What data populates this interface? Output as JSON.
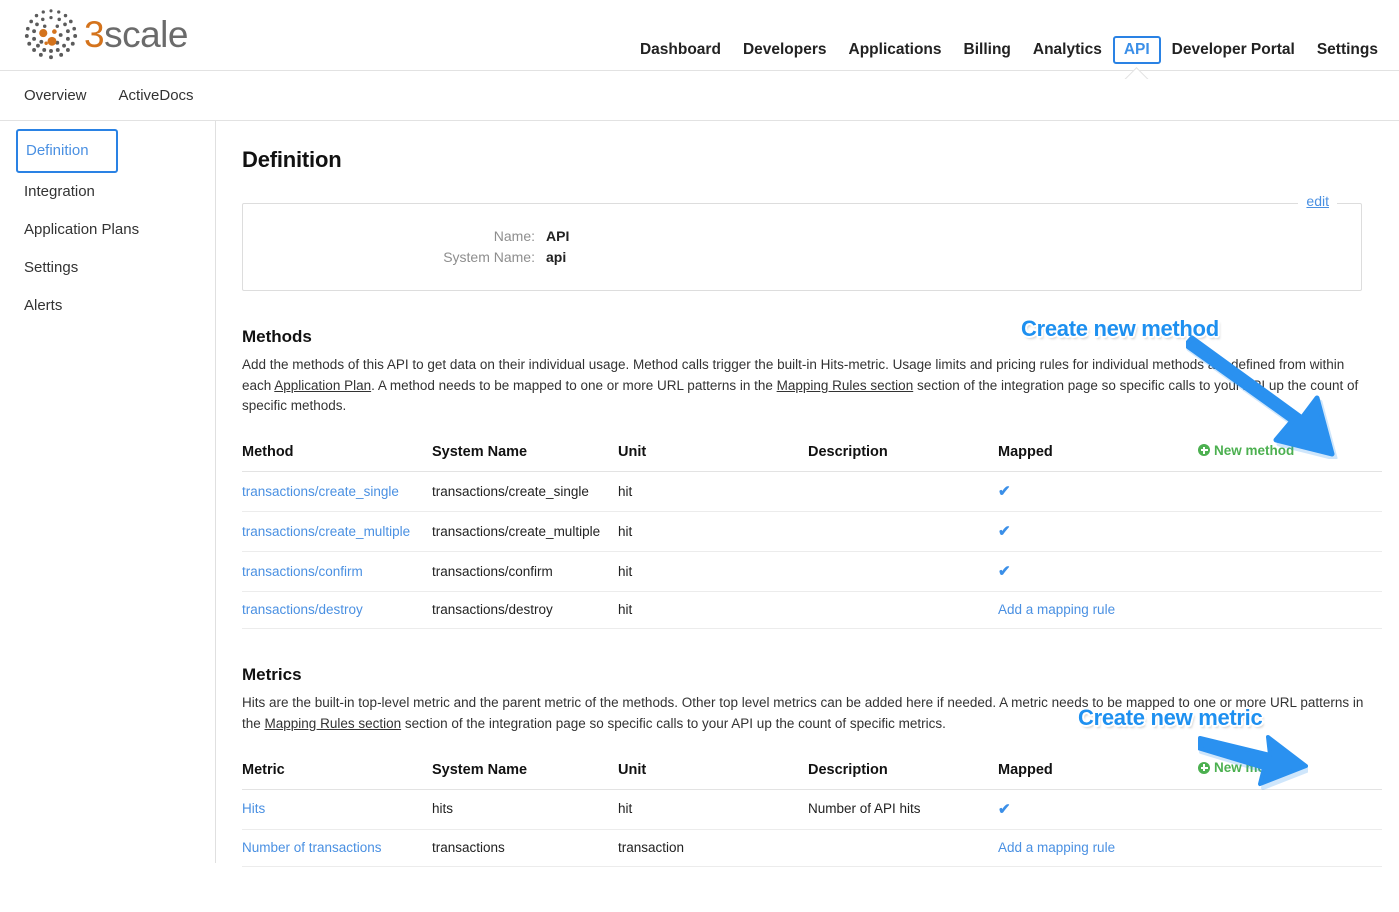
{
  "brand": {
    "logo_text_primary": "3",
    "logo_text_secondary": "scale",
    "logo_icon": "dot-cluster-logo",
    "orange": "#d4731c",
    "gray": "#6b6b6b"
  },
  "header": {
    "nav": [
      {
        "label": "Dashboard",
        "active": false
      },
      {
        "label": "Developers",
        "active": false
      },
      {
        "label": "Applications",
        "active": false
      },
      {
        "label": "Billing",
        "active": false
      },
      {
        "label": "Analytics",
        "active": false
      },
      {
        "label": "API",
        "active": true
      },
      {
        "label": "Developer Portal",
        "active": false
      },
      {
        "label": "Settings",
        "active": false
      }
    ]
  },
  "sub_tabs": [
    {
      "label": "Overview"
    },
    {
      "label": "ActiveDocs"
    }
  ],
  "sidebar": {
    "items": [
      {
        "label": "Definition",
        "active": true
      },
      {
        "label": "Integration",
        "active": false
      },
      {
        "label": "Application Plans",
        "active": false
      },
      {
        "label": "Settings",
        "active": false
      },
      {
        "label": "Alerts",
        "active": false
      }
    ]
  },
  "main": {
    "page_title": "Definition",
    "definition_panel": {
      "edit_label": "edit",
      "rows": [
        {
          "label": "Name:",
          "value": "API"
        },
        {
          "label": "System Name:",
          "value": "api"
        }
      ]
    },
    "methods": {
      "title": "Methods",
      "description_part1": "Add the methods of this API to get data on their individual usage. Method calls trigger the built-in Hits-metric. Usage limits and pricing rules for individual methods are defined from within each ",
      "link1": "Application Plan",
      "description_part2": ". A method needs to be mapped to one or more URL patterns in the ",
      "link2": "Mapping Rules section",
      "description_part3": " section of the integration page so specific calls to your API up the count of specific methods.",
      "new_link": "New method",
      "columns": [
        "Method",
        "System Name",
        "Unit",
        "Description",
        "Mapped"
      ],
      "rows": [
        {
          "name": "transactions/create_single",
          "system_name": "transactions/create_single",
          "unit": "hit",
          "description": "",
          "mapped": true,
          "mapped_label": ""
        },
        {
          "name": "transactions/create_multiple",
          "system_name": "transactions/create_multiple",
          "unit": "hit",
          "description": "",
          "mapped": true,
          "mapped_label": ""
        },
        {
          "name": "transactions/confirm",
          "system_name": "transactions/confirm",
          "unit": "hit",
          "description": "",
          "mapped": true,
          "mapped_label": ""
        },
        {
          "name": "transactions/destroy",
          "system_name": "transactions/destroy",
          "unit": "hit",
          "description": "",
          "mapped": false,
          "mapped_label": "Add a mapping rule"
        }
      ]
    },
    "metrics": {
      "title": "Metrics",
      "description_part1": "Hits are the built-in top-level metric and the parent metric of the methods. Other top level metrics can be added here if needed. A metric needs to be mapped to one or more URL patterns in the ",
      "link1": "Mapping Rules section",
      "description_part2": " section of the integration page so specific calls to your API up the count of specific metrics.",
      "new_link": "New metric",
      "columns": [
        "Metric",
        "System Name",
        "Unit",
        "Description",
        "Mapped"
      ],
      "rows": [
        {
          "name": "Hits",
          "system_name": "hits",
          "unit": "hit",
          "description": "Number of API hits",
          "mapped": true,
          "mapped_label": ""
        },
        {
          "name": "Number of transactions",
          "system_name": "transactions",
          "unit": "transaction",
          "description": "",
          "mapped": false,
          "mapped_label": "Add a mapping rule"
        }
      ]
    }
  },
  "annotations": [
    {
      "text": "Create new method",
      "color": "#1e90f0"
    },
    {
      "text": "Create new metric",
      "color": "#1e90f0"
    }
  ]
}
